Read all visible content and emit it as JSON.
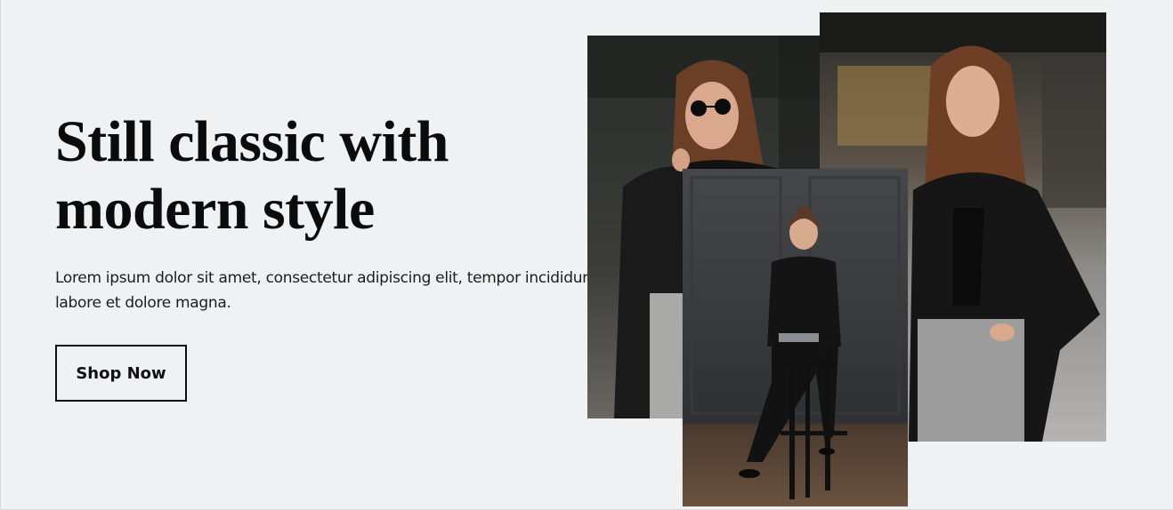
{
  "hero": {
    "headline_line1": "Still classic with",
    "headline_line2": "modern style",
    "description_line1": "Lorem ipsum dolor sit amet, consectetur adipiscing elit, tempor incididunt ut",
    "description_line2": "labore et dolore magna.",
    "cta_label": "Shop Now"
  },
  "gallery": {
    "photos": [
      {
        "name": "woman-in-sunglasses-leather-jacket-photo"
      },
      {
        "name": "woman-in-leather-jacket-street-photo"
      },
      {
        "name": "woman-seated-on-stool-photo"
      }
    ]
  },
  "colors": {
    "background": "#f0f1f3",
    "text": "#0b0b0b",
    "button_border": "#111111"
  }
}
